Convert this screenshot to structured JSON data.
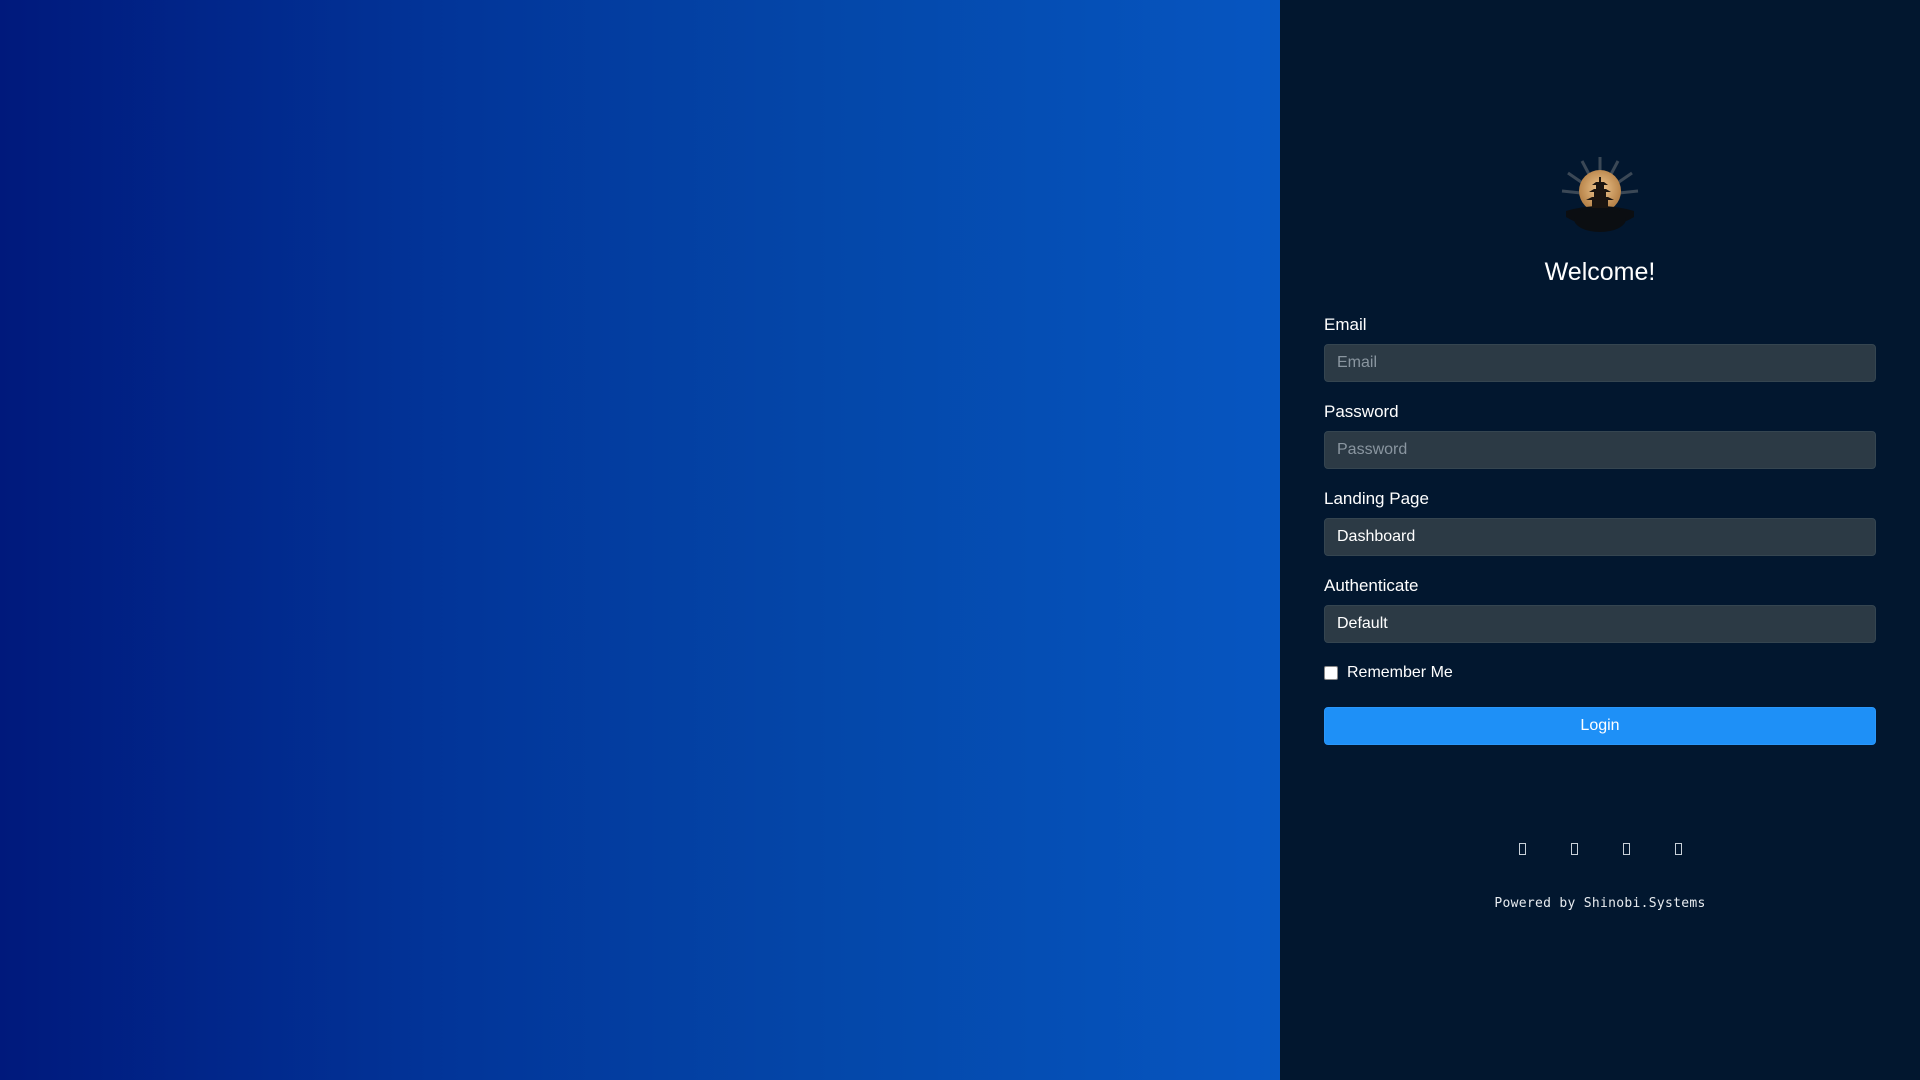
{
  "welcome": "Welcome!",
  "form": {
    "email_label": "Email",
    "email_placeholder": "Email",
    "password_label": "Password",
    "password_placeholder": "Password",
    "landing_label": "Landing Page",
    "landing_value": "Dashboard",
    "auth_label": "Authenticate",
    "auth_value": "Default",
    "remember_label": "Remember Me",
    "remember_checked": false,
    "login_label": "Login"
  },
  "social_icons": [
    "social-link-icon-1",
    "social-link-icon-2",
    "social-link-icon-3",
    "social-link-icon-4"
  ],
  "footer": {
    "powered": "Powered by Shinobi.Systems"
  },
  "colors": {
    "panel_bg": "#02172f",
    "input_bg": "#2c3a45",
    "button": "#1e90f7",
    "hero_start": "#00197c",
    "hero_end": "#0656c1"
  }
}
